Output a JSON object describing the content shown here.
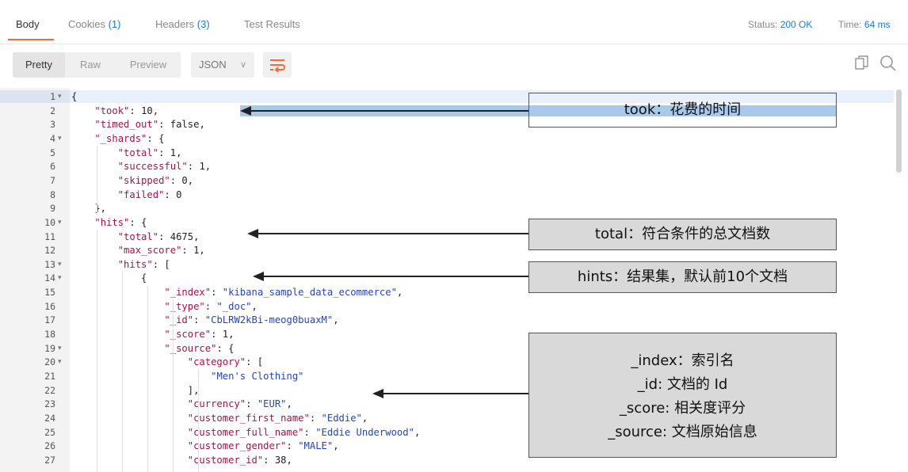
{
  "tabs": [
    {
      "label": "Body",
      "count": ""
    },
    {
      "label": "Cookies",
      "count": "(1)"
    },
    {
      "label": "Headers",
      "count": "(3)"
    },
    {
      "label": "Test Results",
      "count": ""
    }
  ],
  "status": {
    "status_label": "Status:",
    "status_value": "200 OK",
    "time_label": "Time:",
    "time_value": "64 ms"
  },
  "toolbar": {
    "pretty": "Pretty",
    "raw": "Raw",
    "preview": "Preview",
    "format": "JSON",
    "format_icon": "chevron-down-icon",
    "wrap_icon": "wrap-lines-icon",
    "copy_icon": "copy-icon",
    "search_icon": "search-icon"
  },
  "colors": {
    "accent": "#f26b3a",
    "link": "#1a7be0",
    "key": "#a2144b",
    "string": "#2546b7"
  },
  "lines": [
    {
      "n": "1",
      "t": "{"
    },
    {
      "n": "2",
      "t": "    \"took\": 10,"
    },
    {
      "n": "3",
      "t": "    \"timed_out\": false,"
    },
    {
      "n": "4",
      "t": "    \"_shards\": {"
    },
    {
      "n": "5",
      "t": "        \"total\": 1,"
    },
    {
      "n": "6",
      "t": "        \"successful\": 1,"
    },
    {
      "n": "7",
      "t": "        \"skipped\": 0,"
    },
    {
      "n": "8",
      "t": "        \"failed\": 0"
    },
    {
      "n": "9",
      "t": "    },"
    },
    {
      "n": "10",
      "t": "    \"hits\": {"
    },
    {
      "n": "11",
      "t": "        \"total\": 4675,"
    },
    {
      "n": "12",
      "t": "        \"max_score\": 1,"
    },
    {
      "n": "13",
      "t": "        \"hits\": ["
    },
    {
      "n": "14",
      "t": "            {"
    },
    {
      "n": "15",
      "t": "                \"_index\": \"kibana_sample_data_ecommerce\","
    },
    {
      "n": "16",
      "t": "                \"_type\": \"_doc\","
    },
    {
      "n": "17",
      "t": "                \"_id\": \"CbLRW2kBi-meog0buaxM\","
    },
    {
      "n": "18",
      "t": "                \"_score\": 1,"
    },
    {
      "n": "19",
      "t": "                \"_source\": {"
    },
    {
      "n": "20",
      "t": "                    \"category\": ["
    },
    {
      "n": "21",
      "t": "                        \"Men's Clothing\""
    },
    {
      "n": "22",
      "t": "                    ],"
    },
    {
      "n": "23",
      "t": "                    \"currency\": \"EUR\","
    },
    {
      "n": "24",
      "t": "                    \"customer_first_name\": \"Eddie\","
    },
    {
      "n": "25",
      "t": "                    \"customer_full_name\": \"Eddie Underwood\","
    },
    {
      "n": "26",
      "t": "                    \"customer_gender\": \"MALE\","
    },
    {
      "n": "27",
      "t": "                    \"customer_id\": 38,"
    }
  ],
  "foldable": [
    "1",
    "4",
    "10",
    "13",
    "14",
    "19",
    "20"
  ],
  "notes": {
    "took": "took：花费的时间",
    "total": "total：符合条件的总文档数",
    "hits": "hints：结果集，默认前10个文档",
    "fields": [
      "_index：索引名",
      "_id: 文档的 Id",
      "_score: 相关度评分",
      "_source: 文档原始信息"
    ]
  }
}
